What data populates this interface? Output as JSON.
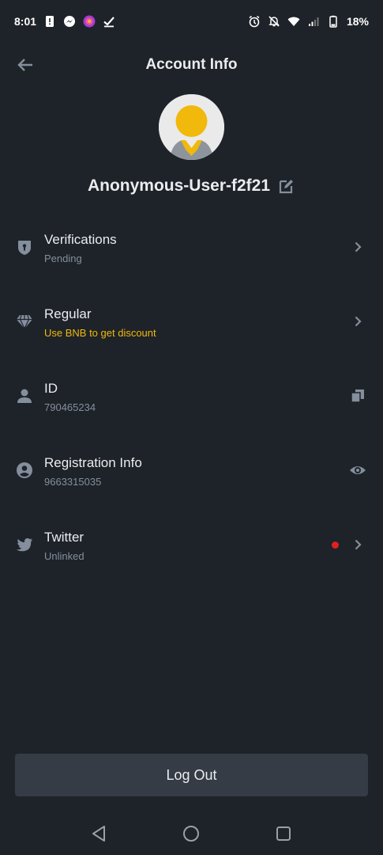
{
  "status_bar": {
    "time": "8:01",
    "battery": "18%",
    "left_icons": [
      "alert-icon",
      "messenger-icon",
      "app-icon",
      "check-icon"
    ],
    "right_icons": [
      "alarm-icon",
      "mute-icon",
      "wifi-icon",
      "signal-icon",
      "battery-icon"
    ]
  },
  "header": {
    "title": "Account Info"
  },
  "profile": {
    "username": "Anonymous-User-f2f21"
  },
  "items": [
    {
      "title": "Verifications",
      "subtitle": "Pending",
      "icon": "shield-icon",
      "action": "chevron-right-icon"
    },
    {
      "title": "Regular",
      "subtitle": "Use BNB to get discount",
      "icon": "diamond-icon",
      "action": "chevron-right-icon"
    },
    {
      "title": "ID",
      "subtitle": "790465234",
      "icon": "person-icon",
      "action": "copy-icon"
    },
    {
      "title": "Registration Info",
      "subtitle": "9663315035",
      "icon": "account-circle-icon",
      "action": "eye-icon"
    },
    {
      "title": "Twitter",
      "subtitle": "Unlinked",
      "icon": "twitter-icon",
      "action": "chevron-right-icon"
    }
  ],
  "logout": {
    "label": "Log Out"
  },
  "colors": {
    "background": "#1e2329",
    "accent": "#f0b90b",
    "muted": "#848e9c",
    "button": "#363c45",
    "notification_dot": "#e02020"
  }
}
